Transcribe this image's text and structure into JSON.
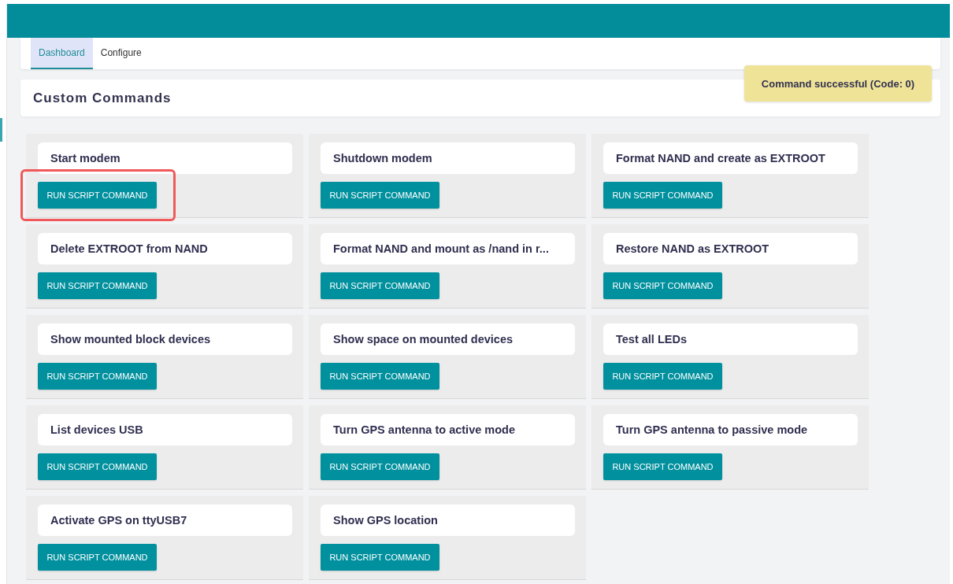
{
  "tabs": [
    {
      "label": "Dashboard",
      "selected": true
    },
    {
      "label": "Configure",
      "selected": false
    }
  ],
  "section": {
    "title": "Custom Commands"
  },
  "toast": {
    "message": "Command successful (Code: 0)"
  },
  "commands": [
    {
      "title": "Start modem",
      "button": "RUN SCRIPT COMMAND",
      "highlighted": true
    },
    {
      "title": "Shutdown modem",
      "button": "RUN SCRIPT COMMAND",
      "highlighted": false
    },
    {
      "title": "Format NAND and create as EXTROOT",
      "button": "RUN SCRIPT COMMAND",
      "highlighted": false
    },
    {
      "title": "Delete EXTROOT from NAND",
      "button": "RUN SCRIPT COMMAND",
      "highlighted": false
    },
    {
      "title": "Format NAND and mount as /nand in r...",
      "button": "RUN SCRIPT COMMAND",
      "highlighted": false
    },
    {
      "title": "Restore NAND as EXTROOT",
      "button": "RUN SCRIPT COMMAND",
      "highlighted": false
    },
    {
      "title": "Show mounted block devices",
      "button": "RUN SCRIPT COMMAND",
      "highlighted": false
    },
    {
      "title": "Show space on mounted devices",
      "button": "RUN SCRIPT COMMAND",
      "highlighted": false
    },
    {
      "title": "Test all LEDs",
      "button": "RUN SCRIPT COMMAND",
      "highlighted": false
    },
    {
      "title": "List devices USB",
      "button": "RUN SCRIPT COMMAND",
      "highlighted": false
    },
    {
      "title": "Turn GPS antenna to active mode",
      "button": "RUN SCRIPT COMMAND",
      "highlighted": false
    },
    {
      "title": "Turn GPS antenna to passive mode",
      "button": "RUN SCRIPT COMMAND",
      "highlighted": false
    },
    {
      "title": "Activate GPS on ttyUSB7",
      "button": "RUN SCRIPT COMMAND",
      "highlighted": false
    },
    {
      "title": "Show GPS location",
      "button": "RUN SCRIPT COMMAND",
      "highlighted": false
    }
  ]
}
